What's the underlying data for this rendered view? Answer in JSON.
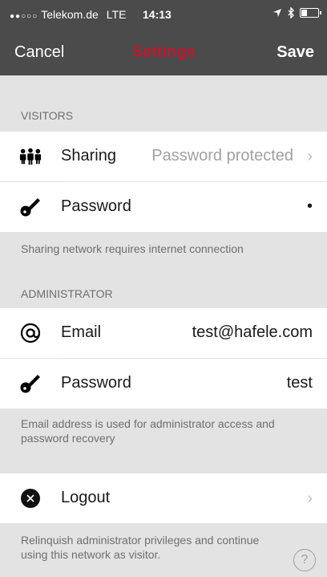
{
  "status": {
    "carrier": "Telekom.de",
    "network": "LTE",
    "time": "14:13"
  },
  "nav": {
    "cancel": "Cancel",
    "title": "Settings",
    "save": "Save"
  },
  "visitors": {
    "header": "VISITORS",
    "sharing": {
      "label": "Sharing",
      "value": "Password protected"
    },
    "password": {
      "label": "Password",
      "value": "•"
    },
    "note": "Sharing network requires internet connection"
  },
  "administrator": {
    "header": "ADMINISTRATOR",
    "email": {
      "label": "Email",
      "value": "test@hafele.com"
    },
    "password": {
      "label": "Password",
      "value": "test"
    },
    "note": "Email address is used for administrator access and password recovery"
  },
  "logout": {
    "label": "Logout",
    "note": "Relinquish administrator privileges and continue using this network as visitor."
  },
  "help": "?"
}
